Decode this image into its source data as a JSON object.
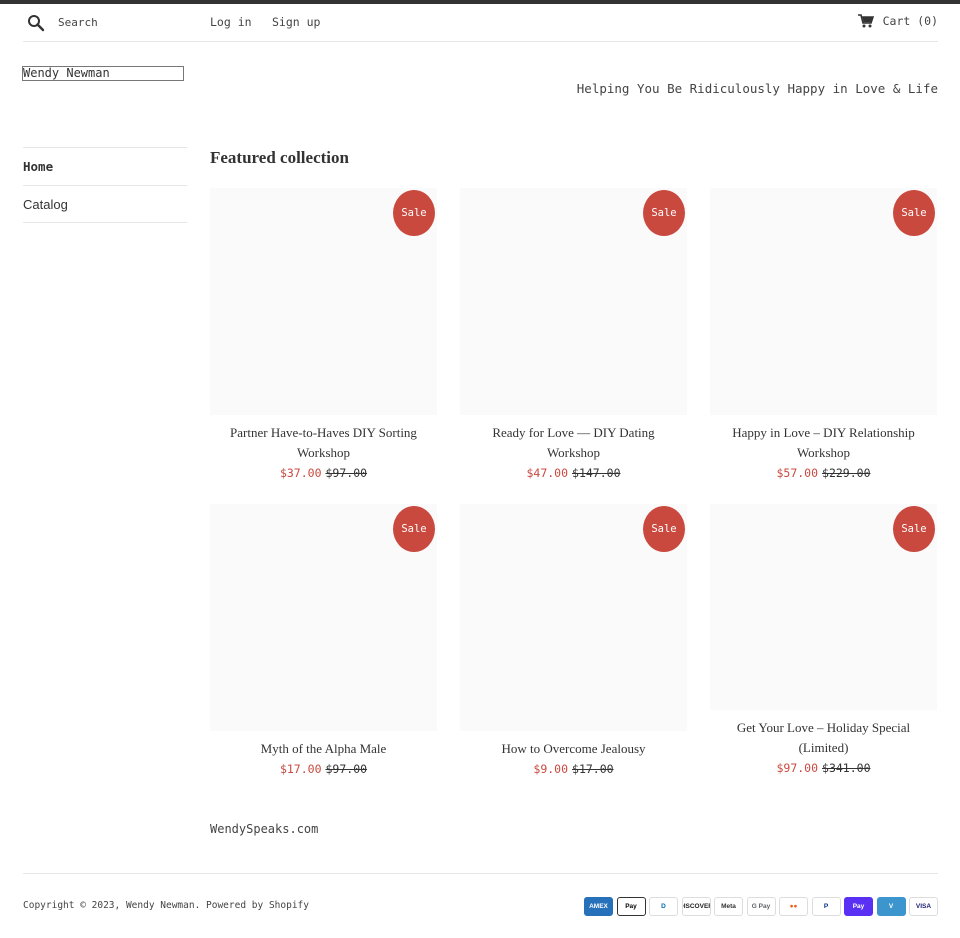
{
  "header": {
    "search_placeholder": "Search",
    "login": "Log in",
    "signup": "Sign up",
    "cart": "Cart (0)"
  },
  "site": {
    "logo": "Wendy Newman",
    "tagline": "Helping You Be Ridiculously Happy in Love & Life"
  },
  "nav": {
    "items": [
      {
        "label": "Home"
      },
      {
        "label": "Catalog"
      }
    ]
  },
  "collection": {
    "title": "Featured collection",
    "sale_label": "Sale",
    "products": [
      {
        "name": "Partner Have-to-Haves DIY Sorting Workshop",
        "price": "$37.00",
        "compare": "$97.00"
      },
      {
        "name": "Ready for Love — DIY Dating Workshop",
        "price": "$47.00",
        "compare": "$147.00"
      },
      {
        "name": "Happy in Love – DIY Relationship Workshop",
        "price": "$57.00",
        "compare": "$229.00"
      },
      {
        "name": "Myth of the Alpha Male",
        "price": "$17.00",
        "compare": "$97.00"
      },
      {
        "name": "How to Overcome Jealousy",
        "price": "$9.00",
        "compare": "$17.00"
      },
      {
        "name": "Get Your Love – Holiday Special (Limited)",
        "price": "$97.00",
        "compare": "$341.00"
      }
    ]
  },
  "footer": {
    "site": "WendySpeaks.com",
    "copyright": "Copyright © 2023, Wendy Newman. Powered by Shopify",
    "payments": [
      {
        "label": "AMEX",
        "icon": "amex-icon",
        "bg": "#2671b9",
        "fg": "#ffffff",
        "border": "#2671b9"
      },
      {
        "label": "Pay",
        "icon": "apple-pay-icon",
        "bg": "#ffffff",
        "fg": "#000000",
        "border": "#333333"
      },
      {
        "label": "D",
        "icon": "diners-club-icon",
        "bg": "#ffffff",
        "fg": "#0069aa",
        "border": "#dddddd"
      },
      {
        "label": "DISCOVER",
        "icon": "discover-icon",
        "bg": "#ffffff",
        "fg": "#222222",
        "border": "#dddddd"
      },
      {
        "label": "Meta",
        "icon": "meta-pay-icon",
        "bg": "#ffffff",
        "fg": "#333333",
        "border": "#dddddd"
      },
      {
        "label": "G Pay",
        "icon": "google-pay-icon",
        "bg": "#ffffff",
        "fg": "#5f6368",
        "border": "#dddddd"
      },
      {
        "label": "●●",
        "icon": "mastercard-icon",
        "bg": "#ffffff",
        "fg": "#eb5f1a",
        "border": "#dddddd"
      },
      {
        "label": "P",
        "icon": "paypal-icon",
        "bg": "#ffffff",
        "fg": "#003087",
        "border": "#dddddd"
      },
      {
        "label": "Pay",
        "icon": "shop-pay-icon",
        "bg": "#5a31f4",
        "fg": "#ffffff",
        "border": "#5a31f4"
      },
      {
        "label": "V",
        "icon": "venmo-icon",
        "bg": "#3d95ce",
        "fg": "#ffffff",
        "border": "#3d95ce"
      },
      {
        "label": "VISA",
        "icon": "visa-icon",
        "bg": "#ffffff",
        "fg": "#1a1f71",
        "border": "#dddddd"
      }
    ]
  }
}
